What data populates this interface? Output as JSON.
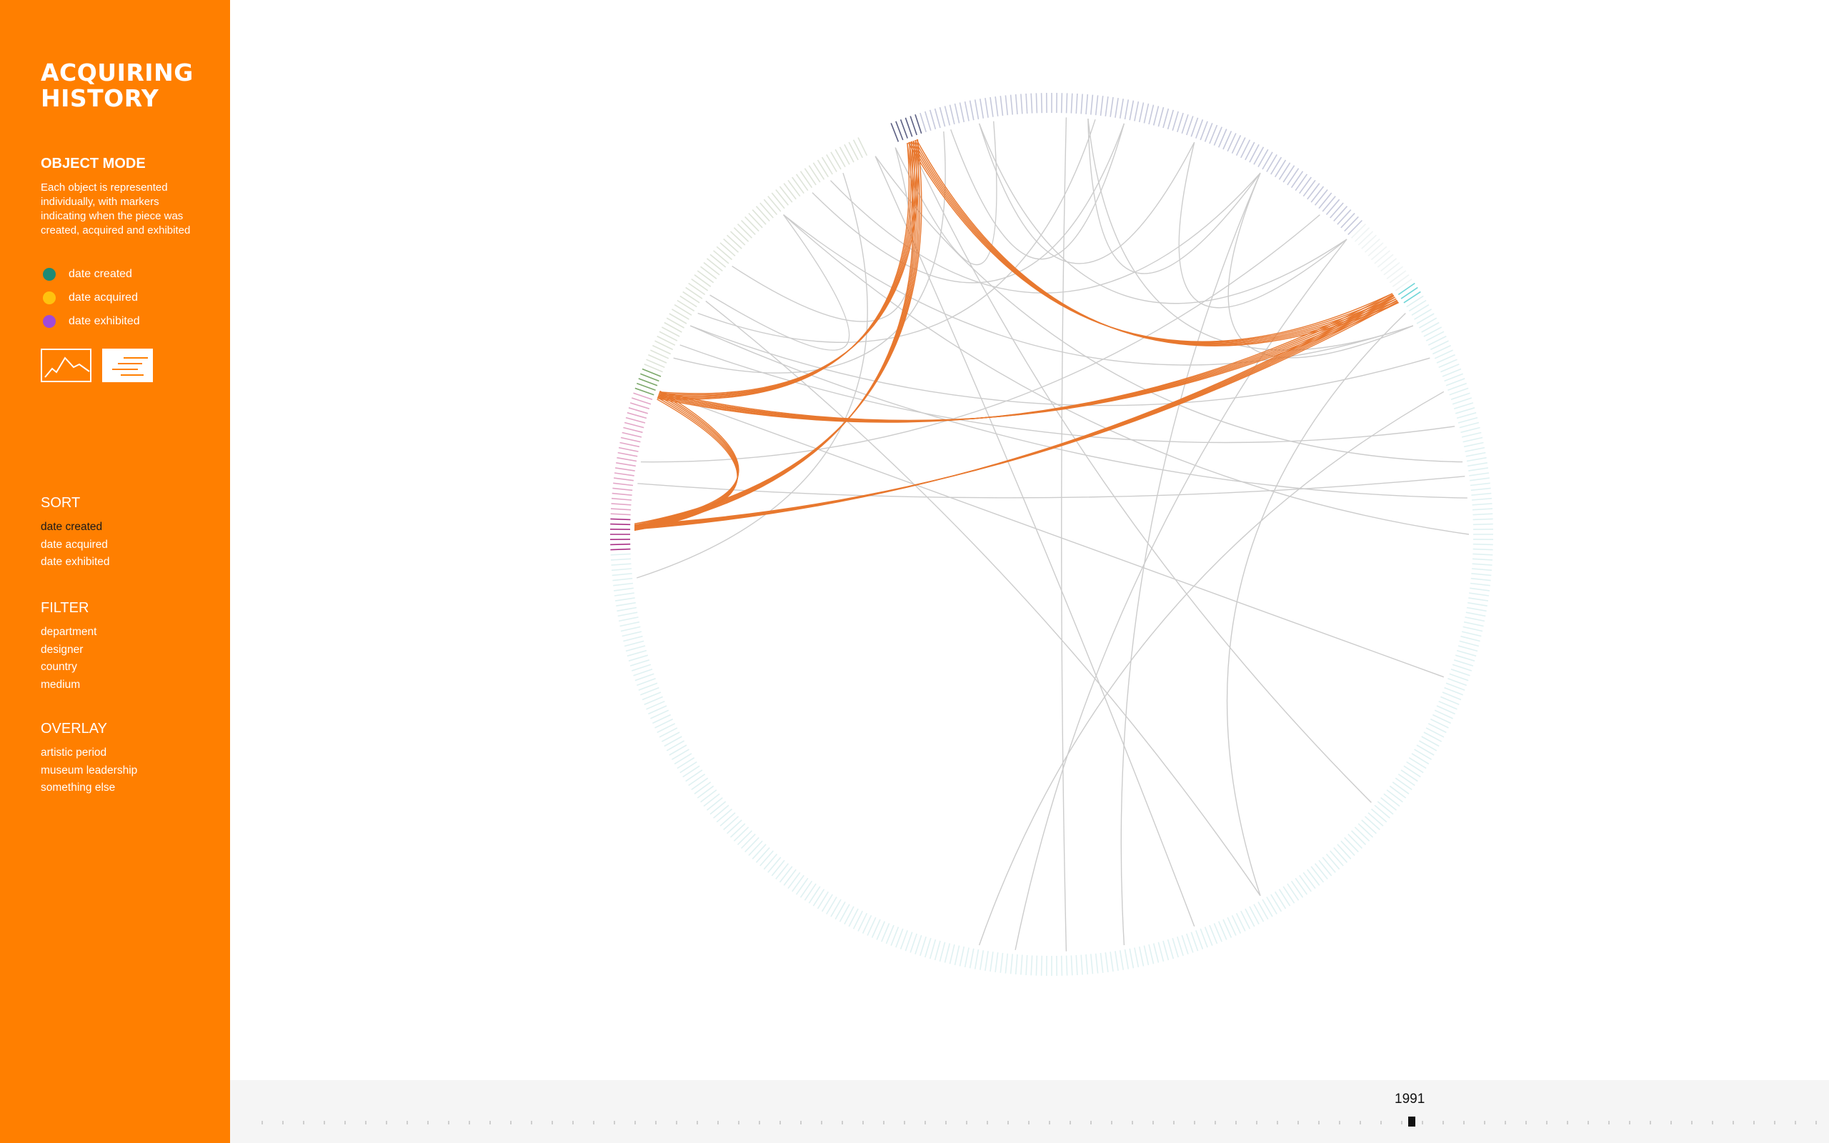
{
  "sidebar": {
    "title_line1": "ACQUIRING",
    "title_line2": "HISTORY",
    "mode_heading": "OBJECT MODE",
    "mode_description": "Each object is represented individually, with markers indicating when the piece was created, acquired and exhibited",
    "legend": [
      {
        "label": "date created",
        "color": "#1f8a74"
      },
      {
        "label": "date acquired",
        "color": "#ffc20e"
      },
      {
        "label": "date exhibited",
        "color": "#a04ad8"
      }
    ],
    "view_buttons": [
      {
        "name": "line-chart-view-icon",
        "active": false
      },
      {
        "name": "list-view-icon",
        "active": true
      }
    ],
    "sort": {
      "heading": "SORT",
      "items": [
        "date created",
        "date acquired",
        "date exhibited"
      ],
      "active": 0
    },
    "filter": {
      "heading": "FILTER",
      "items": [
        "department",
        "designer",
        "country",
        "medium"
      ]
    },
    "overlay": {
      "heading": "OVERLAY",
      "items": [
        "artistic period",
        "museum leadership",
        "something else"
      ]
    }
  },
  "timeline": {
    "current_year": "1991"
  },
  "colors": {
    "accent": "#ff7f00",
    "highlight_link": "#e8782f",
    "grey_link": "#d0d0d0"
  }
}
